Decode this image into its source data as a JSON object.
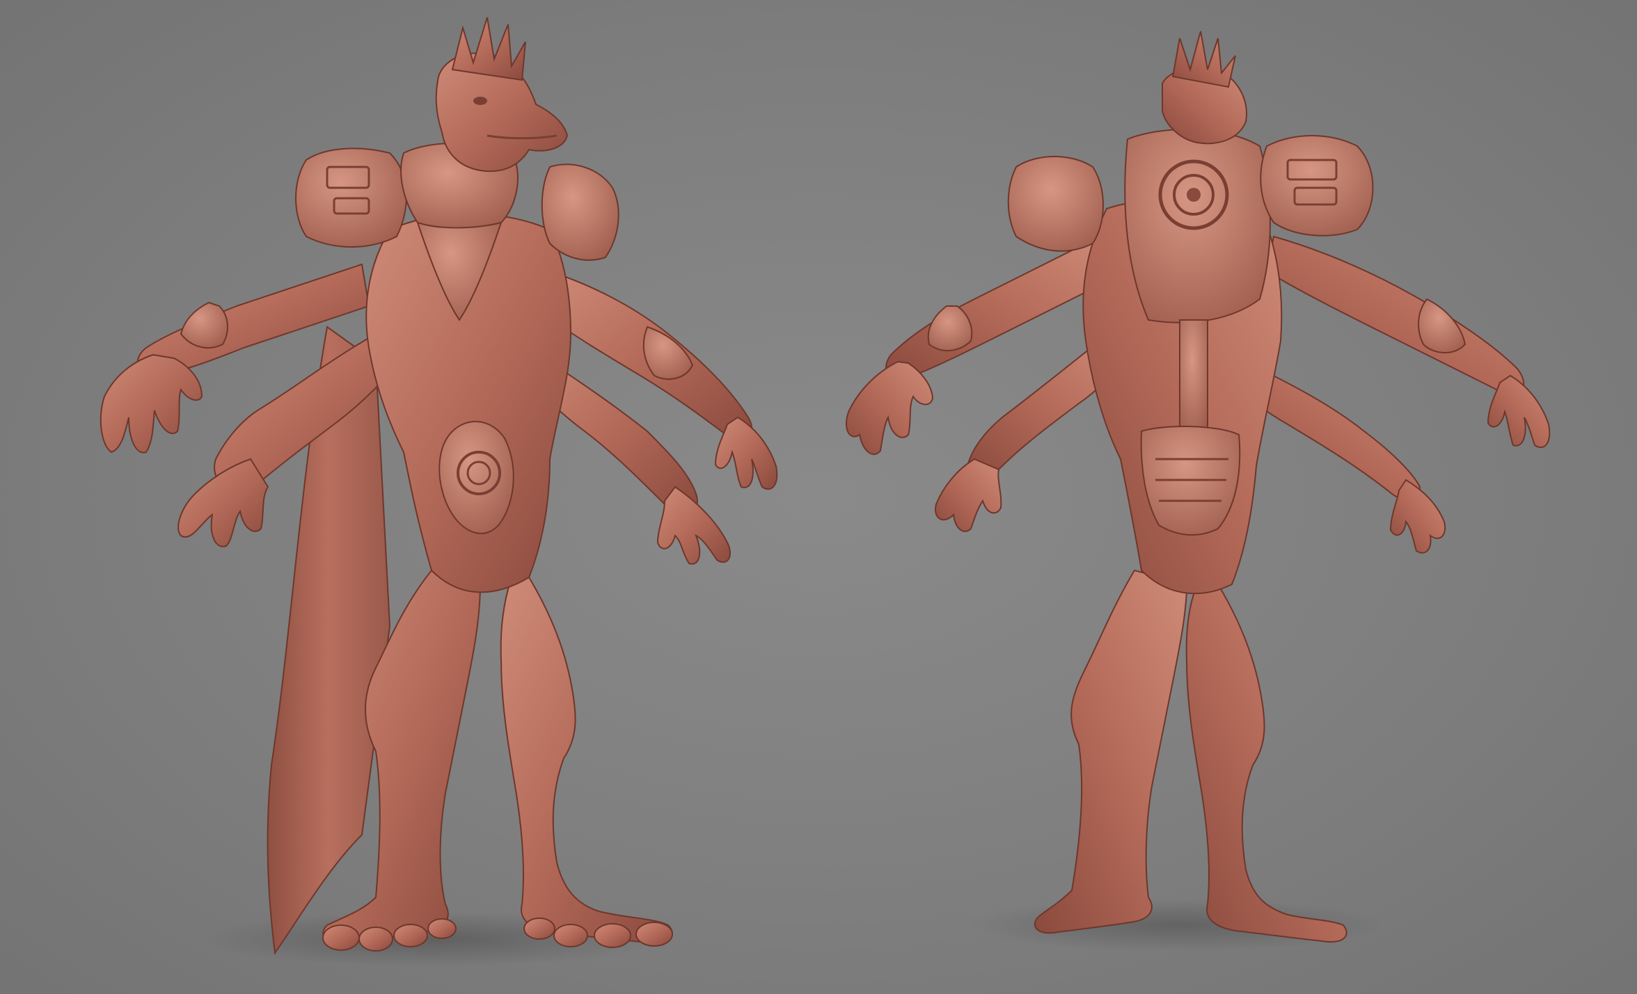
{
  "scene": {
    "background_color": "#808080",
    "subject_color": "#b86e5e",
    "subject_shadow_color": "#7a3f33",
    "subject_highlight_color": "#d89a88"
  },
  "figures": [
    {
      "view": "front"
    },
    {
      "view": "back"
    }
  ]
}
